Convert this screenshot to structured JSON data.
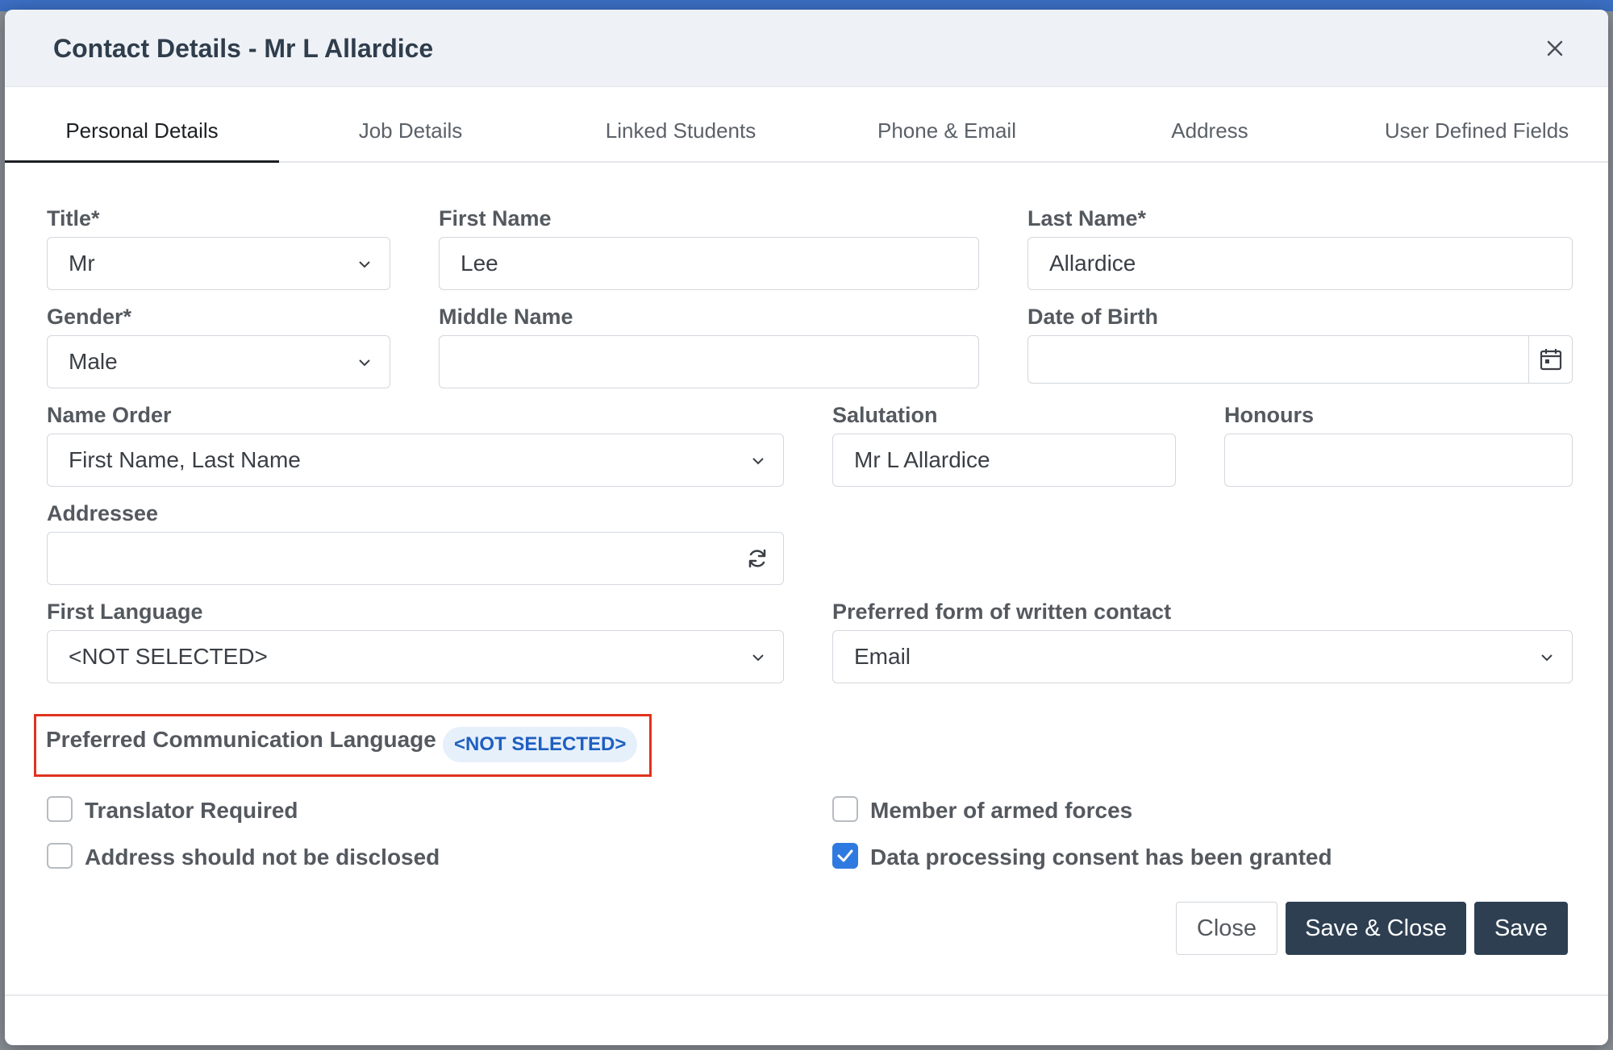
{
  "modal": {
    "title": "Contact Details - Mr L Allardice",
    "close_icon": "close-icon"
  },
  "tabs": [
    {
      "label": "Personal Details",
      "active": true
    },
    {
      "label": "Job Details",
      "active": false
    },
    {
      "label": "Linked Students",
      "active": false
    },
    {
      "label": "Phone & Email",
      "active": false
    },
    {
      "label": "Address",
      "active": false
    },
    {
      "label": "User Defined Fields",
      "active": false
    }
  ],
  "form": {
    "title": {
      "label": "Title*",
      "value": "Mr"
    },
    "first_name": {
      "label": "First Name",
      "value": "Lee"
    },
    "last_name": {
      "label": "Last Name*",
      "value": "Allardice"
    },
    "gender": {
      "label": "Gender*",
      "value": "Male"
    },
    "middle_name": {
      "label": "Middle Name",
      "value": ""
    },
    "dob": {
      "label": "Date of Birth",
      "value": "",
      "icon": "calendar-icon"
    },
    "name_order": {
      "label": "Name Order",
      "value": "First Name, Last Name"
    },
    "salutation": {
      "label": "Salutation",
      "value": "Mr L Allardice"
    },
    "honours": {
      "label": "Honours",
      "value": ""
    },
    "addressee": {
      "label": "Addressee",
      "value": "",
      "icon": "refresh-icon"
    },
    "first_language": {
      "label": "First Language",
      "value": "<NOT SELECTED>"
    },
    "written_contact": {
      "label": "Preferred form of written contact",
      "value": "Email"
    },
    "pref_comm_language": {
      "label": "Preferred Communication Language",
      "value": "<NOT SELECTED>"
    }
  },
  "checkboxes": {
    "translator": {
      "label": "Translator Required",
      "checked": false
    },
    "armed_forces": {
      "label": "Member of armed forces",
      "checked": false
    },
    "address_private": {
      "label": "Address should not be disclosed",
      "checked": false
    },
    "consent": {
      "label": "Data processing consent has been granted",
      "checked": true
    }
  },
  "buttons": {
    "close": "Close",
    "save_close": "Save & Close",
    "save": "Save"
  },
  "colors": {
    "primary_dark": "#2e3f52",
    "accent_blue": "#2f7ae0",
    "highlight_red": "#e0321e"
  }
}
